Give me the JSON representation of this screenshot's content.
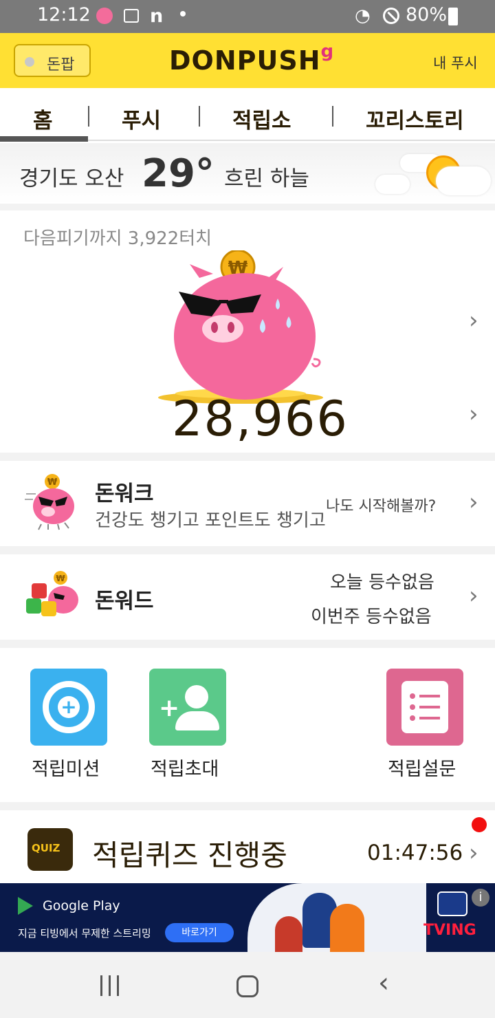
{
  "status_bar": {
    "time": "12:12",
    "battery": "80%"
  },
  "header": {
    "donpop_label": "돈팝",
    "logo": "DONPUSH",
    "logo_mark": "g",
    "my_push": "내 푸시"
  },
  "tabs": [
    {
      "label": "홈"
    },
    {
      "label": "푸시"
    },
    {
      "label": "적립소"
    },
    {
      "label": "꼬리스토리"
    }
  ],
  "weather": {
    "location": "경기도 오산",
    "temperature": "29°",
    "condition": "흐린 하늘"
  },
  "piggy": {
    "next_label": "다음피기까지 3,922터치",
    "points": "28,966"
  },
  "donwalk": {
    "title": "돈워크",
    "subtitle": "건강도 챙기고 포인트도 챙기고",
    "right": "나도 시작해볼까?"
  },
  "donword": {
    "title": "돈워드",
    "today": "오늘 등수없음",
    "week": "이번주 등수없음"
  },
  "quick_actions": [
    {
      "label": "적립미션"
    },
    {
      "label": "적립초대"
    },
    {
      "label": "적립설문"
    }
  ],
  "quiz": {
    "badge": "QUIZ",
    "title": "적립퀴즈 진행중",
    "timer": "01:47:56"
  },
  "ad": {
    "store": "Google Play",
    "text": "지금 티빙에서 무제한 스트리밍",
    "button": "바로가기",
    "brand": "TVING",
    "info": "i"
  },
  "colors": {
    "header": "#ffe033",
    "pig": "#f4689c",
    "mission": "#3ab1ef",
    "invite": "#5bc98a",
    "survey": "#de6790"
  }
}
